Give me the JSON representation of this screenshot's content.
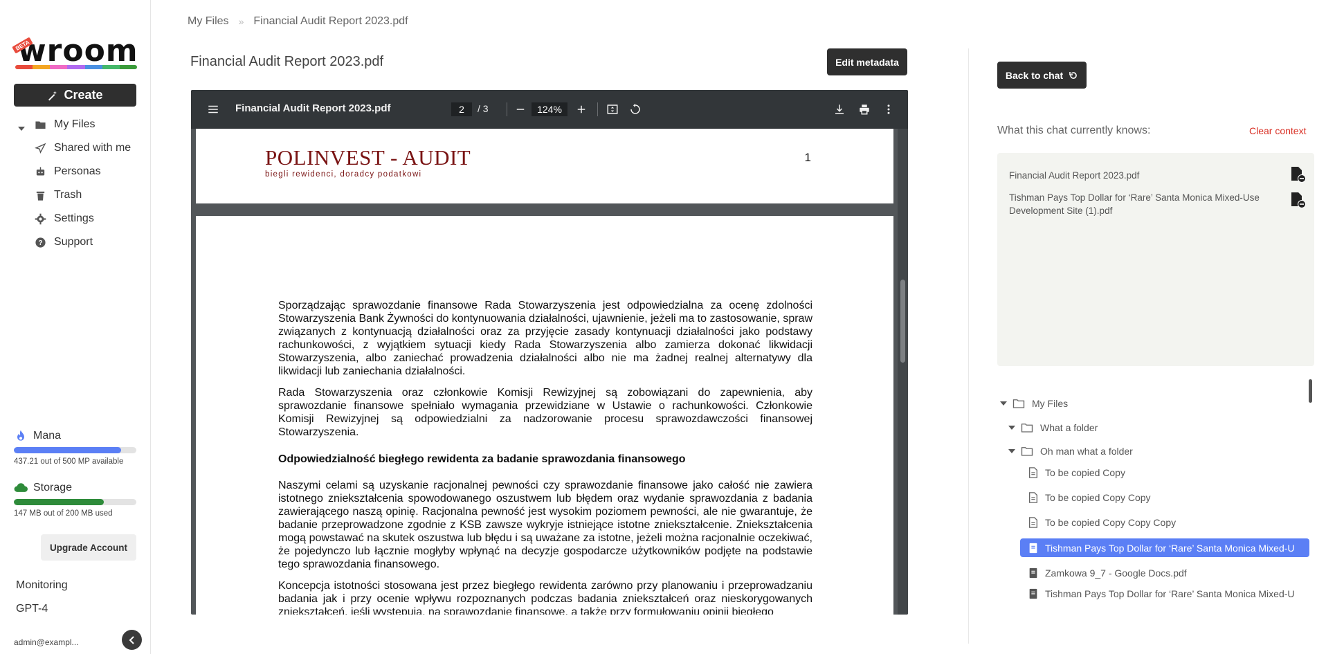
{
  "sidebar": {
    "logo_text": "wroom",
    "logo_badge": "BETA",
    "logo_colors": [
      "#e84b3c",
      "#f4a623",
      "#f06ac4",
      "#b06af0",
      "#4a90e2",
      "#44b86a",
      "#3a9b3a"
    ],
    "create_label": "Create",
    "nav": [
      {
        "label": "My Files",
        "icon": "folder-icon"
      },
      {
        "label": "Shared with me",
        "icon": "send-icon"
      },
      {
        "label": "Personas",
        "icon": "robot-icon"
      },
      {
        "label": "Trash",
        "icon": "trash-icon"
      },
      {
        "label": "Settings",
        "icon": "gear-icon"
      },
      {
        "label": "Support",
        "icon": "help-icon"
      }
    ],
    "mana": {
      "label": "Mana",
      "text": "437.21 out of 500 MP available",
      "fraction": 0.874,
      "color": "#5b7ff5"
    },
    "storage": {
      "label": "Storage",
      "text": "147 MB out of 200 MB used",
      "fraction": 0.735,
      "color": "#2e8b3a"
    },
    "upgrade_label": "Upgrade Account",
    "monitoring_label": "Monitoring",
    "model_label": "GPT-4",
    "user": "admin@exampl..."
  },
  "breadcrumb": {
    "root": "My Files",
    "separator": "»",
    "current": "Financial Audit Report 2023.pdf"
  },
  "document": {
    "title": "Financial Audit Report 2023.pdf",
    "edit_label": "Edit metadata"
  },
  "viewer": {
    "file_name": "Financial Audit Report 2023.pdf",
    "page_current": "2",
    "page_total": "/   3",
    "zoom": "124%",
    "page1": {
      "brand": "POLINVEST - AUDIT",
      "brand_sub": "biegli rewidenci, doradcy podatkowi",
      "page_number": "1"
    },
    "page2": {
      "p1": "Sporządzając sprawozdanie finansowe Rada Stowarzyszenia jest odpowiedzialna za ocenę zdolności Stowarzyszenia Bank Żywności do kontynuowania działalności, ujawnienie, jeżeli ma to zastosowanie, spraw związanych z kontynuacją działalności oraz za przyjęcie zasady kontynuacji działalności jako podstawy rachunkowości, z wyjątkiem sytuacji kiedy Rada Stowarzyszenia albo zamierza dokonać likwidacji Stowarzyszenia, albo zaniechać prowadzenia działalności albo nie ma żadnej realnej alternatywy dla likwidacji lub zaniechania działalności.",
      "p2": "Rada Stowarzyszenia oraz członkowie Komisji Rewizyjnej są  zobowiązani do zapewnienia, aby sprawozdanie finansowe spełniało wymagania przewidziane w Ustawie o rachunkowości. Członkowie Komisji Rewizyjnej są odpowiedzialni za nadzorowanie procesu sprawozdawczości finansowej Stowarzyszenia.",
      "heading": "Odpowiedzialność biegłego rewidenta za badanie sprawozdania finansowego",
      "p3": "Naszymi celami są uzyskanie racjonalnej pewności czy sprawozdanie finansowe jako całość nie zawiera istotnego zniekształcenia spowodowanego oszustwem lub błędem oraz wydanie sprawozdania z badania zawierającego naszą opinię. Racjonalna pewność jest wysokim poziomem pewności, ale nie gwarantuje, że badanie przeprowadzone zgodnie z KSB zawsze wykryje istniejące istotne zniekształcenie. Zniekształcenia mogą powstawać na skutek oszustwa lub błędu i są uważane za istotne, jeżeli można racjonalnie oczekiwać, że pojedynczo lub łącznie mogłyby wpłynąć na decyzje gospodarcze użytkowników podjęte na podstawie tego sprawozdania finansowego.",
      "p4": "Koncepcja istotności stosowana jest przez biegłego rewidenta zarówno przy planowaniu i przeprowadzaniu badania jak i przy ocenie wpływu rozpoznanych podczas badania zniekształceń oraz nieskorygowanych zniekształceń, jeśli występują, na sprawozdanie finansowe, a także przy formułowaniu opinii biegłego"
    }
  },
  "chat_panel": {
    "back_label": "Back to chat",
    "knows_label": "What this chat currently knows:",
    "clear_label": "Clear context",
    "context_items": [
      "Financial Audit Report 2023.pdf",
      "Tishman Pays Top Dollar for ‘Rare’ Santa Monica Mixed-Use Development Site (1).pdf"
    ],
    "tree": [
      {
        "label": "My Files",
        "type": "folder",
        "depth": 0,
        "expanded": true
      },
      {
        "label": "What a folder",
        "type": "folder",
        "depth": 1,
        "expanded": true
      },
      {
        "label": "Oh man what a folder",
        "type": "folder",
        "depth": 1,
        "expanded": true
      },
      {
        "label": "To be copied Copy",
        "type": "doc",
        "depth": 2
      },
      {
        "label": "To be copied Copy Copy",
        "type": "doc",
        "depth": 2
      },
      {
        "label": "To be copied Copy Copy Copy",
        "type": "doc",
        "depth": 2
      },
      {
        "label": "Tishman Pays Top Dollar for ‘Rare’ Santa Monica Mixed-U",
        "type": "book",
        "depth": 2,
        "selected": true
      },
      {
        "label": "Zamkowa 9_7 - Google Docs.pdf",
        "type": "book",
        "depth": 2
      },
      {
        "label": "Tishman Pays Top Dollar for ‘Rare’ Santa Monica Mixed-U",
        "type": "book",
        "depth": 2
      }
    ]
  }
}
